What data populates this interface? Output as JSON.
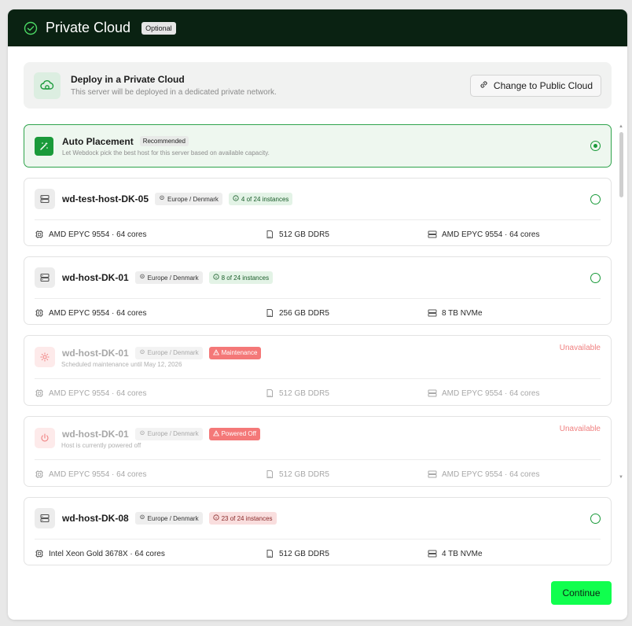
{
  "header": {
    "title": "Private Cloud",
    "badge": "Optional"
  },
  "deploy": {
    "title": "Deploy in a Private Cloud",
    "subtitle": "This server will be deployed in a dedicated private network.",
    "button_label": "Change to Public Cloud"
  },
  "auto": {
    "title": "Auto Placement",
    "badge": "Recommended",
    "description": "Let Webdock pick the best host for this server based on available capacity.",
    "selected": true
  },
  "hosts": [
    {
      "name": "wd-test-host-DK-05",
      "location": "Europe / Denmark",
      "status": "4 of 24 instances",
      "cpu": "AMD EPYC 9554 · 64 cores",
      "ram": "512 GB DDR5",
      "storage": "AMD EPYC 9554 · 64 cores"
    },
    {
      "name": "wd-host-DK-01",
      "location": "Europe / Denmark",
      "status": "8 of 24 instances",
      "cpu": "AMD EPYC 9554 · 64 cores",
      "ram": "256 GB DDR5",
      "storage": "8 TB NVMe"
    },
    {
      "name": "wd-host-DK-01",
      "location": "Europe / Denmark",
      "status": "Maintenance",
      "sub": "Scheduled maintenance until May 12, 2026",
      "unavailable": "Unavailable",
      "cpu": "AMD EPYC 9554 · 64 cores",
      "ram": "512 GB DDR5",
      "storage": "AMD EPYC 9554 · 64 cores"
    },
    {
      "name": "wd-host-DK-01",
      "location": "Europe / Denmark",
      "status": "Powered Off",
      "sub": "Host is currently powered off",
      "unavailable": "Unavailable",
      "cpu": "AMD EPYC 9554 · 64 cores",
      "ram": "512 GB DDR5",
      "storage": "AMD EPYC 9554 · 64 cores"
    },
    {
      "name": "wd-host-DK-08",
      "location": "Europe / Denmark",
      "status": "23 of 24 instances",
      "cpu": "Intel Xeon Gold 3678X · 64 cores",
      "ram": "512 GB DDR5",
      "storage": "4 TB NVMe"
    }
  ],
  "footer": {
    "continue_label": "Continue"
  },
  "colors": {
    "header_bg": "#0a2212",
    "accent": "#1a9a3a",
    "continue_bg": "#10ff4e",
    "unavailable": "#f08080"
  }
}
